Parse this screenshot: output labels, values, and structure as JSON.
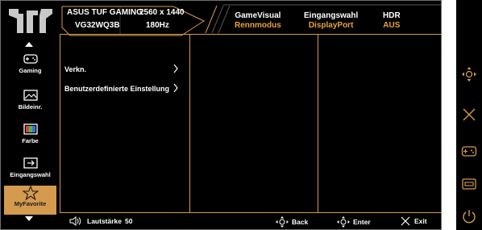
{
  "header": {
    "brand": "ASUS TUF GAMING",
    "model": "VG32WQ3B",
    "resolution": "2560 x 1440",
    "refresh": "180Hz",
    "status": [
      {
        "label": "GameVisual",
        "value": "Rennmodus"
      },
      {
        "label": "Eingangswahl",
        "value": "DisplayPort"
      },
      {
        "label": "HDR",
        "value": "AUS"
      }
    ]
  },
  "sidebar": {
    "items": [
      {
        "label": "Gaming",
        "icon": "gamepad-icon"
      },
      {
        "label": "Bildeinr.",
        "icon": "image-icon"
      },
      {
        "label": "Farbe",
        "icon": "color-icon"
      },
      {
        "label": "Eingangswahl",
        "icon": "input-icon"
      },
      {
        "label": "MyFavorite",
        "icon": "star-icon",
        "active": true
      }
    ]
  },
  "menu": {
    "items": [
      {
        "label": "Verkn."
      },
      {
        "label": "Benutzerdefinierte Einstellung"
      }
    ]
  },
  "footer": {
    "volume_label": "Lautstärke",
    "volume_value": "50",
    "back_label": "Back",
    "enter_label": "Enter",
    "exit_label": "Exit"
  },
  "colors": {
    "accent": "#d49a4e",
    "status_value": "#e8a23d",
    "background": "#000000"
  }
}
